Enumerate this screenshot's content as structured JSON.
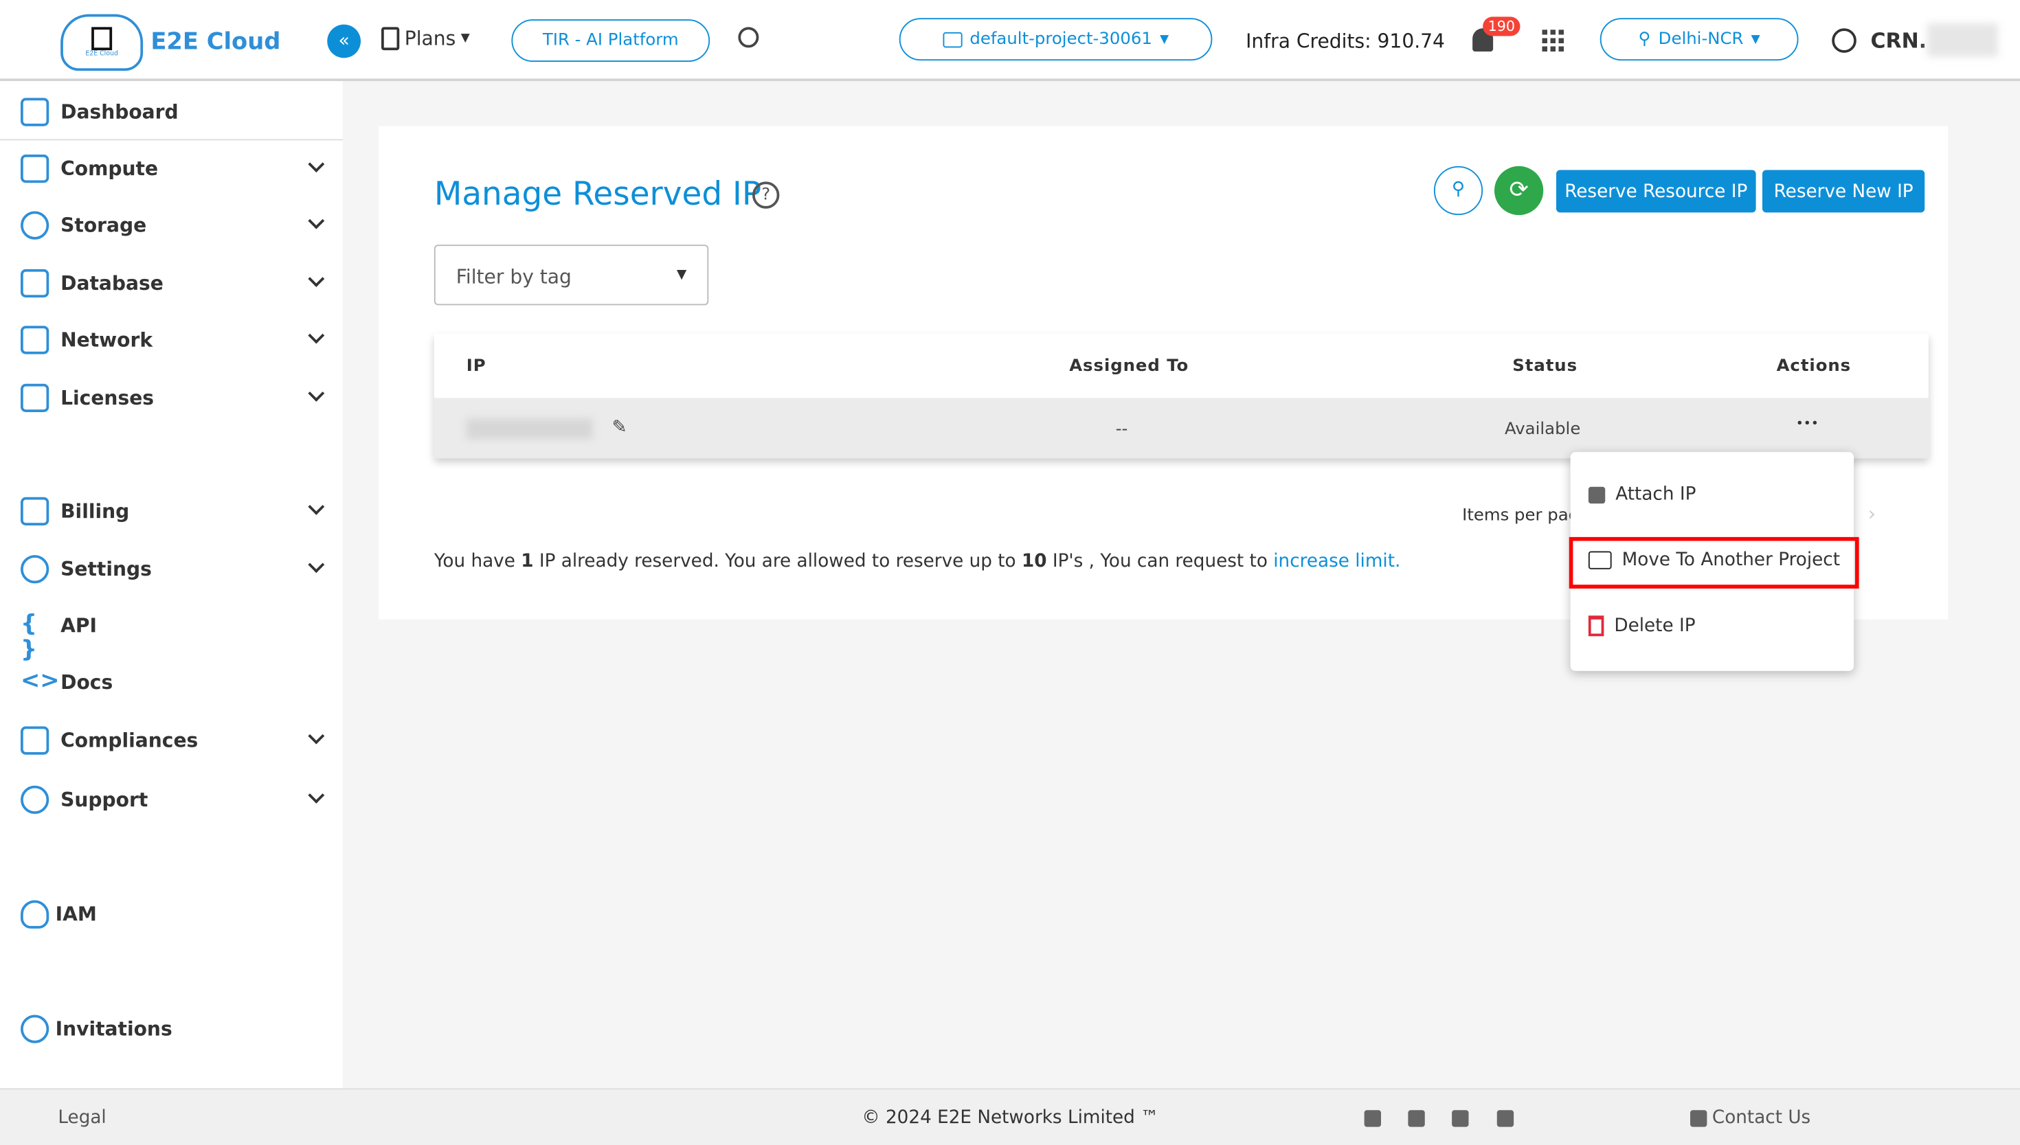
{
  "header": {
    "brand": "E2E Cloud",
    "logo_text": "E2E Cloud",
    "plans": "Plans",
    "tir": "TIR - AI Platform",
    "project": "default-project-30061",
    "credits": "Infra Credits: 910.74",
    "notifications": "190",
    "region": "Delhi-NCR",
    "user": "CRN."
  },
  "sidebar": {
    "items": [
      {
        "label": "Dashboard"
      },
      {
        "label": "Compute"
      },
      {
        "label": "Storage"
      },
      {
        "label": "Database"
      },
      {
        "label": "Network"
      },
      {
        "label": "Licenses"
      },
      {
        "label": "Billing"
      },
      {
        "label": "Settings"
      },
      {
        "label": "API"
      },
      {
        "label": "Docs"
      },
      {
        "label": "Compliances"
      },
      {
        "label": "Support"
      },
      {
        "label": "IAM"
      },
      {
        "label": "Invitations"
      }
    ]
  },
  "main": {
    "title": "Manage Reserved IP",
    "filter_placeholder": "Filter by tag",
    "reserve_resource": "Reserve Resource IP",
    "reserve_new": "Reserve New IP",
    "columns": [
      "IP",
      "Assigned To",
      "Status",
      "Actions"
    ],
    "rows": [
      {
        "ip": "",
        "assigned": "--",
        "status": "Available",
        "actions": "•••"
      }
    ],
    "items_per_page": "Items per pag",
    "notice": {
      "a": "You have ",
      "b": "1",
      "c": " IP already reserved. You are allowed to reserve up to ",
      "d": "10",
      "e": " IP's , You can request to ",
      "link": "increase limit."
    }
  },
  "menu": {
    "items": [
      "Attach IP",
      "Move To Another Project",
      "Delete IP"
    ]
  },
  "footer": {
    "legal": "Legal",
    "copyright": "© 2024 E2E Networks Limited ™",
    "contact": "Contact Us"
  },
  "colors": {
    "accent": "#0d8fd8",
    "refresh": "#2ea84a",
    "highlight": "#ff0000",
    "badge": "#f44336"
  }
}
